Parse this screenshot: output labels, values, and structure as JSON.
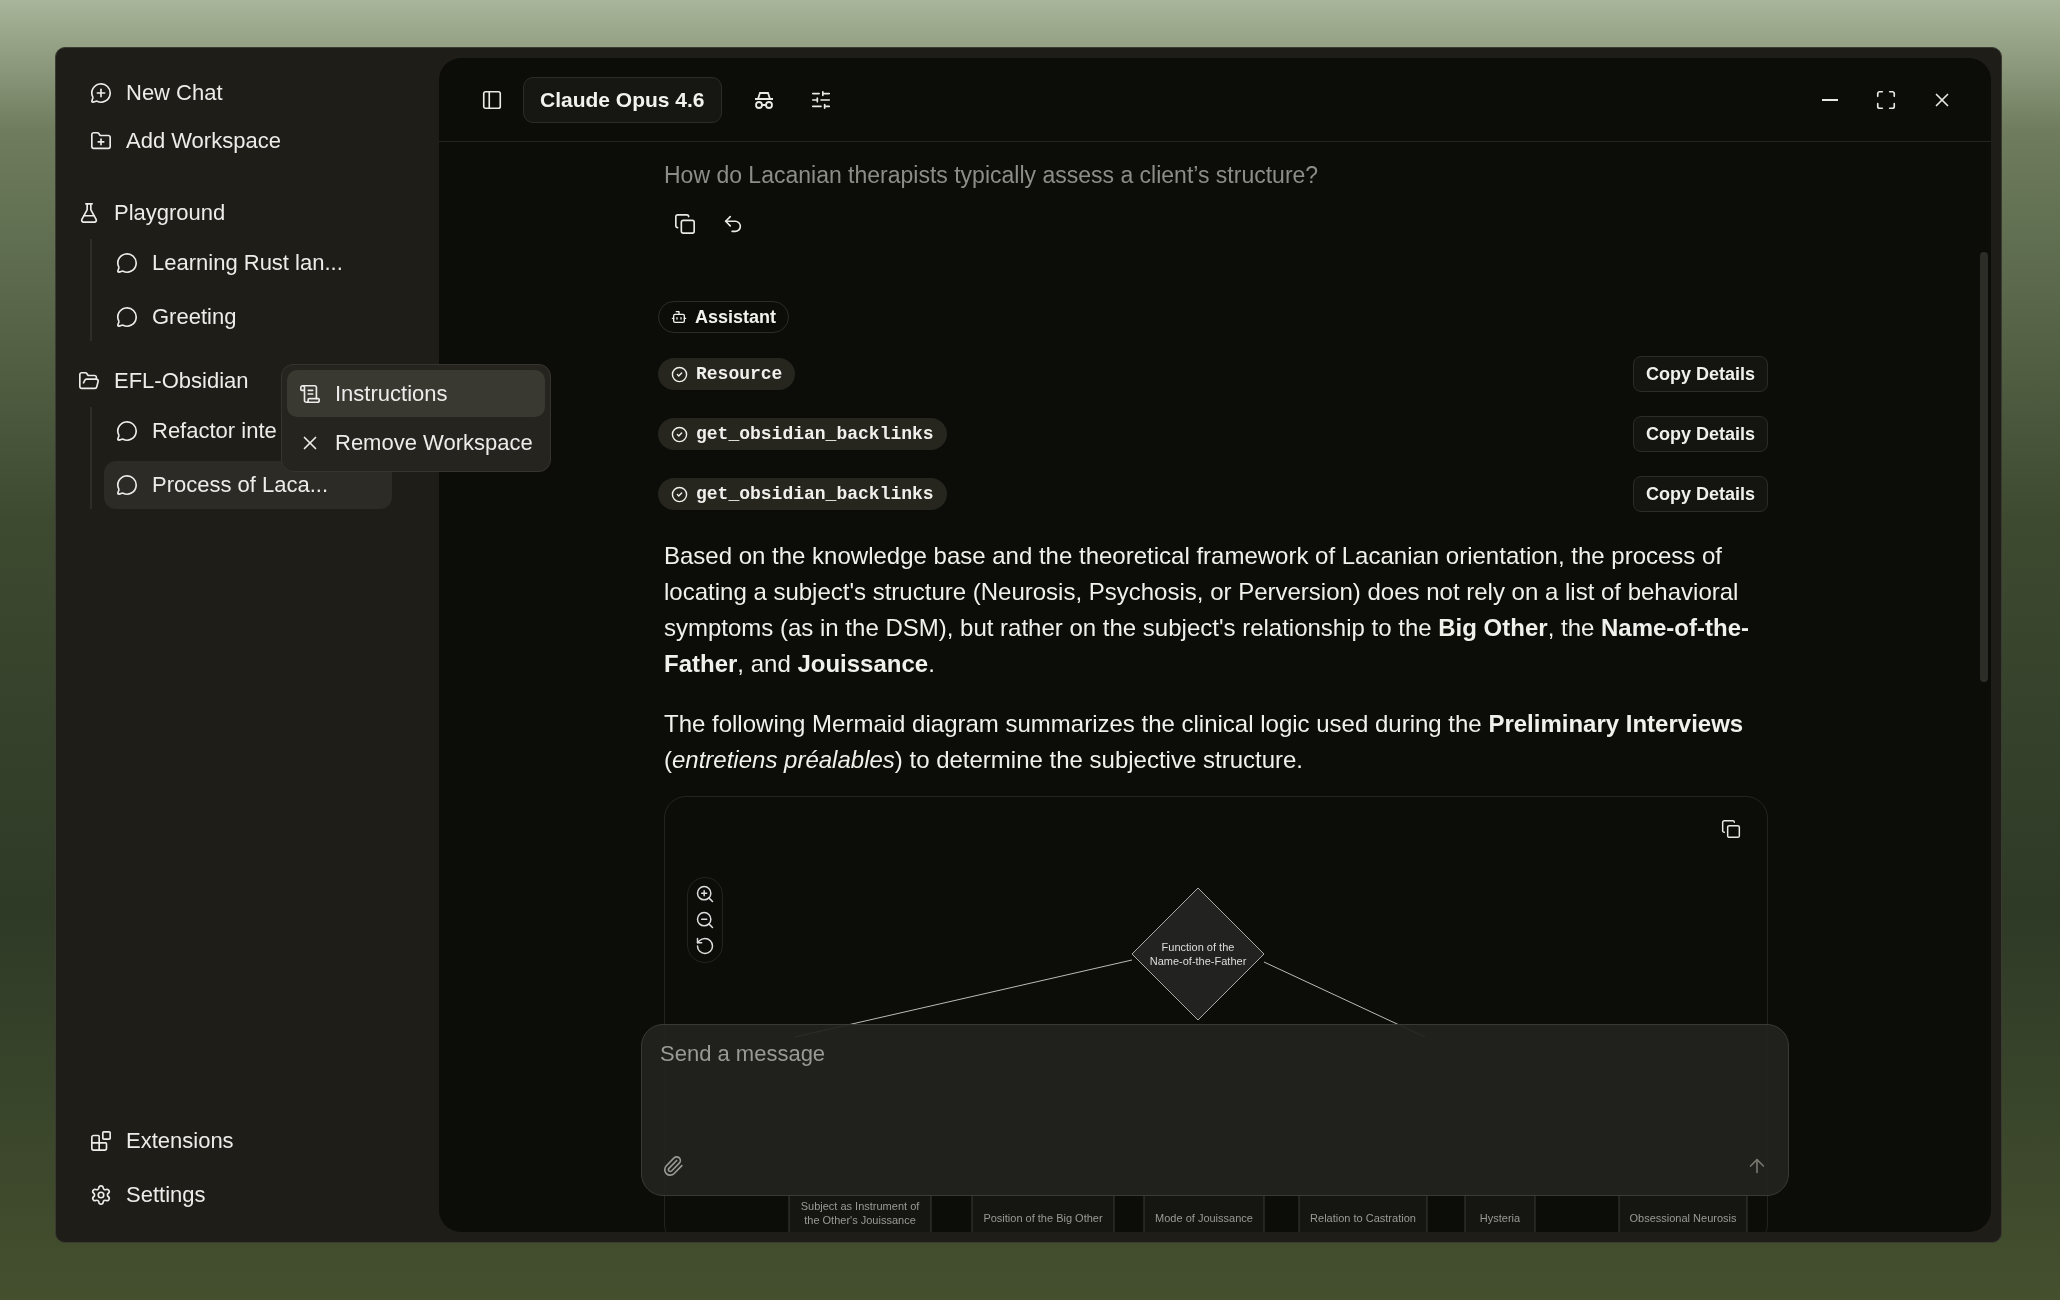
{
  "sidebar": {
    "top_actions": [
      {
        "label": "New Chat",
        "kind": "new-chat"
      },
      {
        "label": "Add Workspace",
        "kind": "add-workspace"
      }
    ],
    "workspaces": [
      {
        "name": "Playground",
        "kind": "playground",
        "chats": [
          {
            "title": "Learning Rust lan...",
            "selected": false
          },
          {
            "title": "Greeting",
            "selected": false
          }
        ]
      },
      {
        "name": "EFL-Obsidian",
        "kind": "folder",
        "chats": [
          {
            "title": "Refactor inte",
            "selected": false
          },
          {
            "title": "Process of Laca...",
            "selected": true
          }
        ]
      }
    ],
    "context_menu": {
      "items": [
        {
          "label": "Instructions",
          "kind": "instructions",
          "selected": true
        },
        {
          "label": "Remove Workspace",
          "kind": "remove",
          "selected": false
        }
      ]
    },
    "bottom_actions": [
      {
        "label": "Extensions",
        "kind": "extensions"
      },
      {
        "label": "Settings",
        "kind": "settings"
      }
    ]
  },
  "header": {
    "model": "Claude Opus 4.6"
  },
  "conversation": {
    "user_message": "How do Lacanian therapists typically assess a client’s structure?",
    "assistant_label": "Assistant",
    "tool_calls": [
      {
        "name": "Resource",
        "action": "Copy Details"
      },
      {
        "name": "get_obsidian_backlinks",
        "action": "Copy Details"
      },
      {
        "name": "get_obsidian_backlinks",
        "action": "Copy Details"
      }
    ],
    "paragraphs": [
      "Based on the knowledge base and the theoretical framework of Lacanian orientation, the process of locating a subject's structure (Neurosis, Psychosis, or Perversion) does not rely on a list of behavioral symptoms (as in the DSM), but rather on the subject's relationship to the **Big Other**, the **Name-of-the-Father**, and **Jouissance**.",
      "The following Mermaid diagram summarizes the clinical logic used during the **Preliminary Interviews** (*entretiens préalables*) to determine the subjective structure."
    ],
    "diagram": {
      "decision_lines": [
        "Function of the",
        "Name-of-the-Father"
      ],
      "nodes": [
        {
          "lines": [
            "Subject as Instrument of",
            "the Other's Jouissance"
          ]
        },
        {
          "lines": [
            "Position of the Big Other"
          ]
        },
        {
          "lines": [
            "Mode of Jouissance"
          ]
        },
        {
          "lines": [
            "Relation to Castration"
          ]
        },
        {
          "lines": [
            "Hysteria"
          ]
        },
        {
          "lines": [
            "Obsessional Neurosis"
          ]
        }
      ]
    }
  },
  "composer": {
    "placeholder": "Send a message"
  }
}
